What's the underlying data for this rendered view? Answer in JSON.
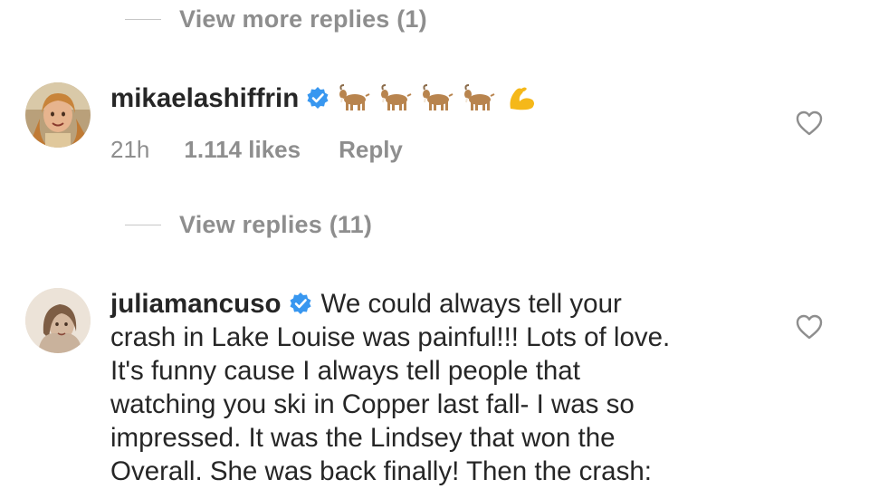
{
  "thread": {
    "view_more_label": "View more replies (1)",
    "view_replies_label": "View replies (11)"
  },
  "comments": [
    {
      "username": "mikaelashiffrin",
      "verified": true,
      "text": "",
      "emojis": [
        "goat-emoji",
        "goat-emoji",
        "goat-emoji",
        "goat-emoji",
        "flexed-biceps-emoji"
      ],
      "time": "21h",
      "likes": "1.114 likes",
      "reply_label": "Reply"
    },
    {
      "username": "juliamancuso",
      "verified": true,
      "text_lines": [
        "We could always tell your",
        "crash in Lake Louise was painful!!! Lots of love.",
        "It's funny cause I always tell people that",
        "watching you ski in Copper last fall- I was so",
        "impressed. It was the Lindsey that won the",
        "Overall. She was back finally! Then the crash:"
      ]
    }
  ],
  "colors": {
    "text": "#262626",
    "secondary": "#8e8e8e",
    "verified_blue": "#3897f0",
    "divider": "#c7c7c7"
  },
  "icons": {
    "verified": "verified-badge-icon",
    "like": "heart-outline-icon"
  }
}
